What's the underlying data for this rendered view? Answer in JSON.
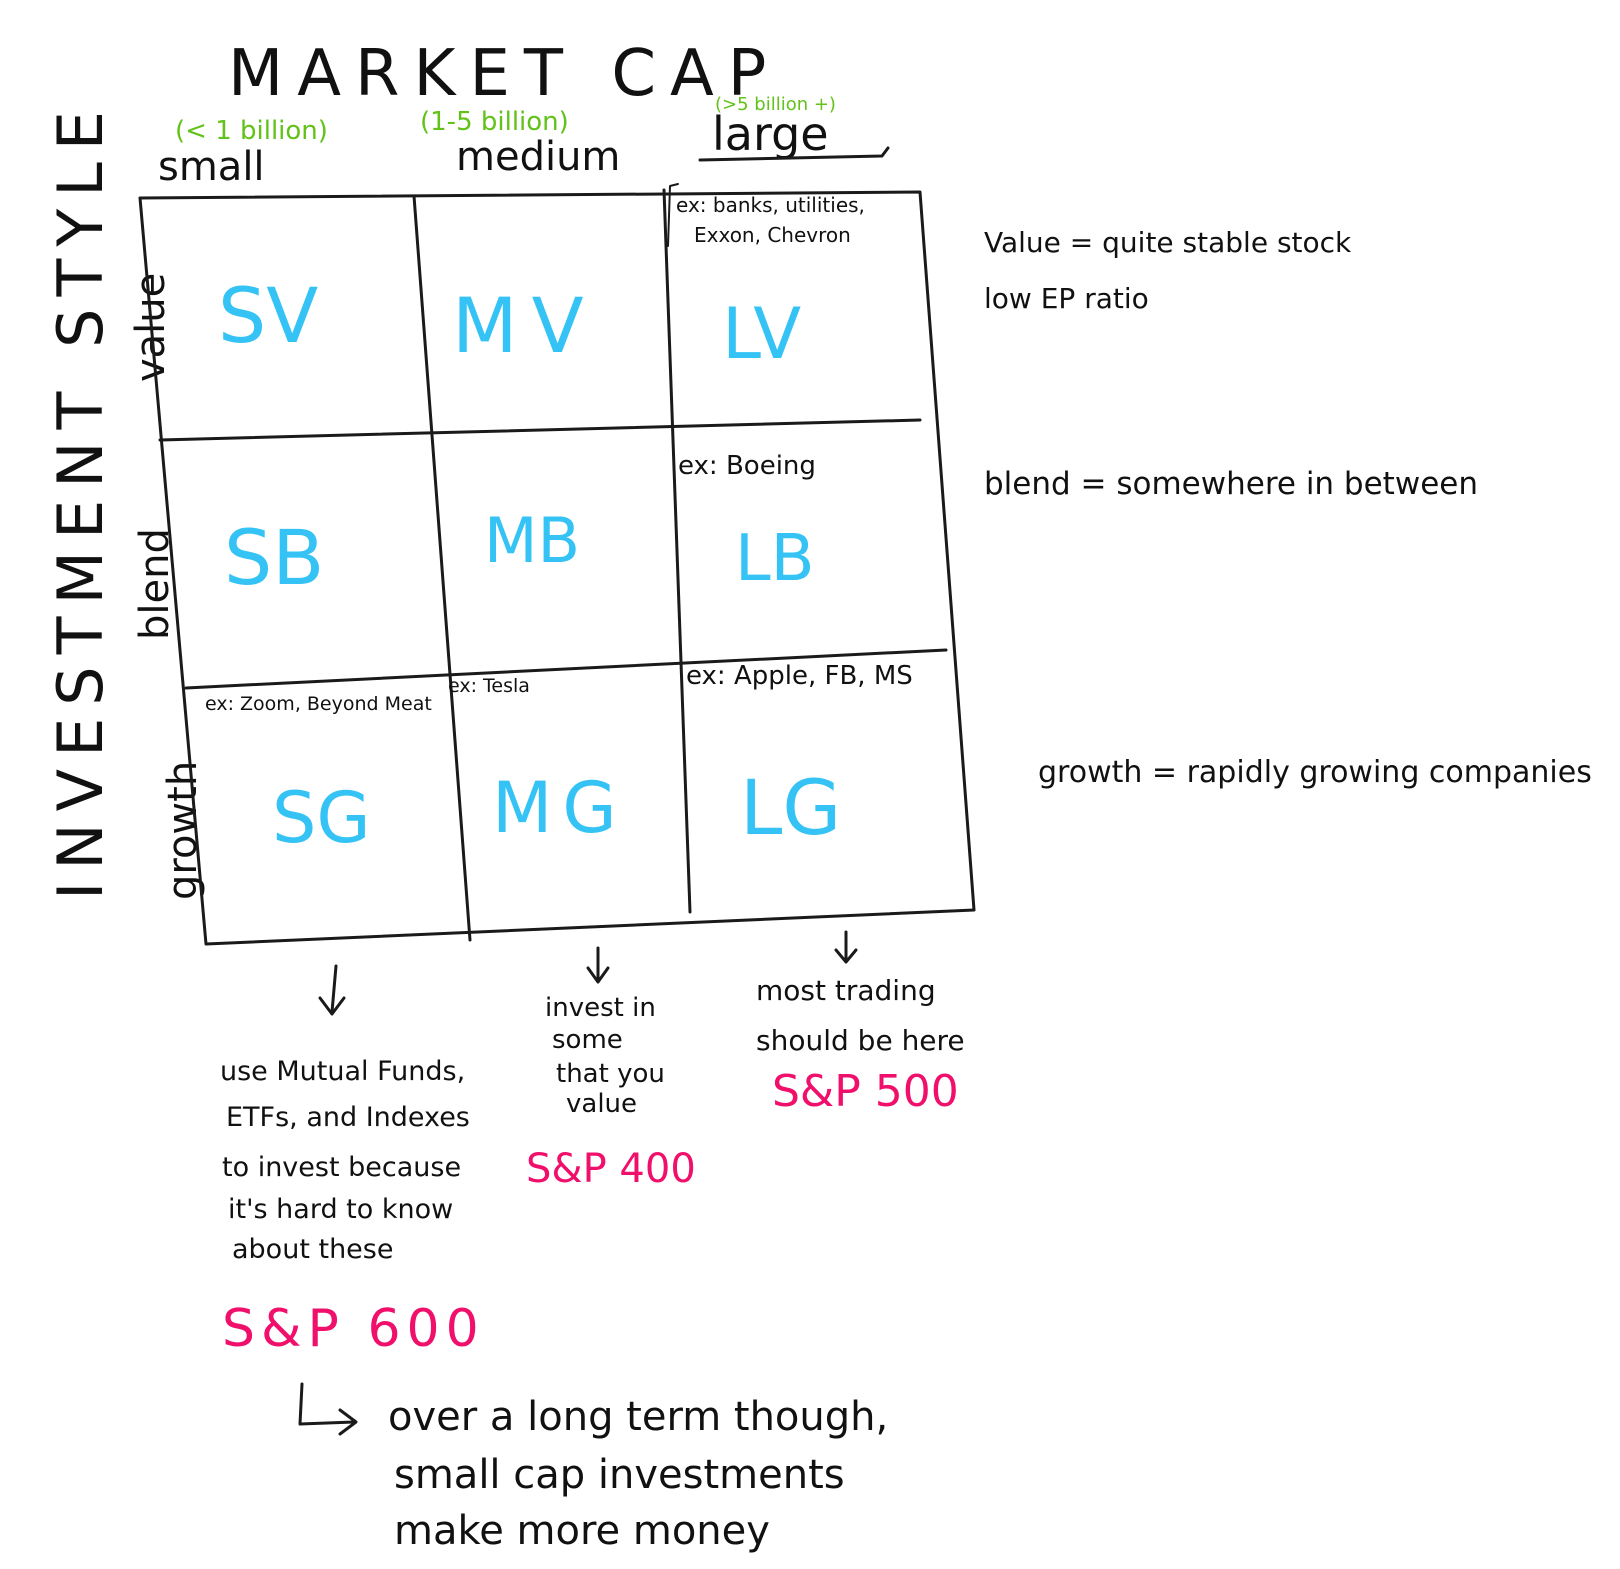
{
  "title": "MARKET CAP",
  "side_title": "INVESTMENT STYLE",
  "columns": [
    {
      "label": "small",
      "range": "(< 1 billion)"
    },
    {
      "label": "medium",
      "range": "(1-5 billion)"
    },
    {
      "label": "large",
      "range": "(>5 billion +)"
    }
  ],
  "rows": [
    {
      "label": "value"
    },
    {
      "label": "blend"
    },
    {
      "label": "growth"
    }
  ],
  "cells": {
    "sv": "SV",
    "mv": "MV",
    "lv": "LV",
    "sb": "SB",
    "mb": "MB",
    "lb": "LB",
    "sg": "SG",
    "mg": "MG",
    "lg": "LG"
  },
  "examples": {
    "lv_1": "ex: banks, utilities,",
    "lv_2": "Exxon, Chevron",
    "lb": "ex: Boeing",
    "sg": "ex: Zoom, Beyond Meat",
    "mg": "ex: Tesla",
    "lg": "ex: Apple, FB, MS"
  },
  "definitions": {
    "value_1": "Value = quite stable stock",
    "value_2": "low EP ratio",
    "blend": "blend = somewhere in between",
    "growth": "growth = rapidly growing companies"
  },
  "notes": {
    "small_1": "use Mutual Funds,",
    "small_2": "ETFs, and Indexes",
    "small_3": "to invest because",
    "small_4": "it's hard to know",
    "small_5": "about these",
    "medium_1": "invest in",
    "medium_2": "some",
    "medium_3": "that you",
    "medium_4": "value",
    "large_1": "most trading",
    "large_2": "should be here",
    "footer_1": "over a long term though,",
    "footer_2": "small cap investments",
    "footer_3": "make more money"
  },
  "indexes": {
    "small": "S&P 600",
    "medium": "S&P 400",
    "large": "S&P 500"
  },
  "colors": {
    "ink": "#111111",
    "cell_text": "#34c3f4",
    "range_text": "#62c21a",
    "index_text": "#f0106b"
  }
}
